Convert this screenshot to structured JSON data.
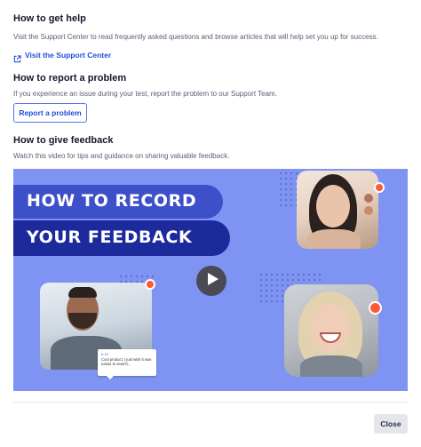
{
  "help": {
    "heading": "How to get help",
    "text": "Visit the Support Center to read frequently asked questions and browse articles that will help set you up for success.",
    "link_label": "Visit the Support Center",
    "link_icon": "external-link-icon"
  },
  "report": {
    "heading": "How to report a problem",
    "text": "If you experience an issue during your test, report the problem to our Support Team.",
    "button_label": "Report a problem"
  },
  "feedback": {
    "heading": "How to give feedback",
    "text": "Watch this video for tips and guidance on sharing valuable feedback.",
    "video": {
      "title_line1": "HOW TO RECORD",
      "title_line2": "YOUR FEEDBACK",
      "play_icon": "play-icon",
      "comment_meta": "0:16",
      "comment_text": "Cool product. I just wish it was easier to search...",
      "background_color": "#7e93f2",
      "record_dot_color": "#ff5a36"
    }
  },
  "footer": {
    "close_label": "Close"
  },
  "colors": {
    "accent": "#1f4fd8",
    "heading": "#15162e",
    "body_text": "#5b5e74"
  }
}
